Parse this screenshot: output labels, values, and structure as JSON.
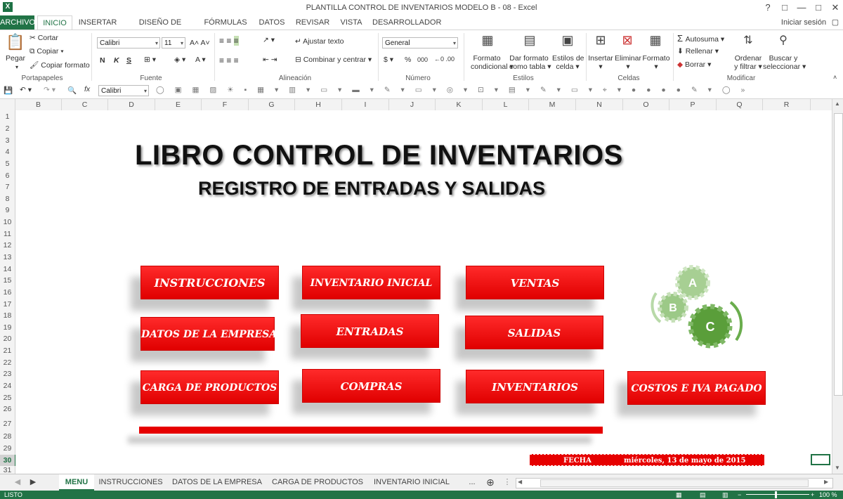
{
  "window": {
    "title": "PLANTILLA CONTROL DE INVENTARIOS MODELO B - 08 - Excel",
    "help": "?",
    "restore": "□",
    "minimize": "—",
    "maximize": "□",
    "close": "✕"
  },
  "ribbon_tabs": [
    "ARCHIVO",
    "INICIO",
    "INSERTAR",
    "DISEÑO DE PÁGINA",
    "FÓRMULAS",
    "DATOS",
    "REVISAR",
    "VISTA",
    "DESARROLLADOR"
  ],
  "signin": "Iniciar sesión",
  "ribbon": {
    "clipboard": {
      "paste": "Pegar",
      "cut": "Cortar",
      "copy": "Copiar",
      "format_painter": "Copiar formato",
      "label": "Portapapeles"
    },
    "font": {
      "name": "Calibri",
      "size": "11",
      "bold": "N",
      "italic": "K",
      "underline": "S",
      "label": "Fuente"
    },
    "alignment": {
      "wrap": "Ajustar texto",
      "merge": "Combinar y centrar",
      "label": "Alineación"
    },
    "number": {
      "format": "General",
      "percent": "%",
      "thousands": "000",
      "label": "Número"
    },
    "styles": {
      "conditional_1": "Formato",
      "conditional_2": "condicional",
      "table_1": "Dar formato",
      "table_2": "como tabla",
      "cell_1": "Estilos de",
      "cell_2": "celda",
      "label": "Estilos"
    },
    "cells": {
      "insert": "Insertar",
      "delete": "Eliminar",
      "format": "Formato",
      "label": "Celdas"
    },
    "editing": {
      "autosum": "Autosuma",
      "fill": "Rellenar",
      "clear": "Borrar",
      "sort_1": "Ordenar",
      "sort_2": "y filtrar",
      "find_1": "Buscar y",
      "find_2": "seleccionar",
      "label": "Modificar"
    }
  },
  "qat_font": "Calibri",
  "columns": [
    "B",
    "C",
    "D",
    "E",
    "F",
    "G",
    "H",
    "I",
    "J",
    "K",
    "L",
    "M",
    "N",
    "O",
    "P",
    "Q",
    "R"
  ],
  "rows": [
    "1",
    "2",
    "3",
    "4",
    "5",
    "6",
    "7",
    "8",
    "9",
    "10",
    "11",
    "12",
    "13",
    "14",
    "15",
    "16",
    "17",
    "18",
    "19",
    "20",
    "21",
    "22",
    "23",
    "24",
    "25",
    "26",
    "27",
    "28",
    "29",
    "30",
    "31"
  ],
  "selected_row": "30",
  "sheet": {
    "title": "LIBRO CONTROL DE INVENTARIOS",
    "subtitle": "REGISTRO DE ENTRADAS Y SALIDAS",
    "buttons": {
      "instrucciones": "INSTRUCCIONES",
      "inventario_inicial": "INVENTARIO INICIAL",
      "ventas": "VENTAS",
      "datos_empresa": "DATOS DE LA EMPRESA",
      "entradas": "ENTRADAS",
      "salidas": "SALIDAS",
      "carga_productos": "CARGA DE PRODUCTOS",
      "compras": "COMPRAS",
      "inventarios": "INVENTARIOS",
      "costos_iva": "COSTOS E IVA PAGADO"
    },
    "gears": {
      "a": "A",
      "b": "B",
      "c": "C"
    },
    "fecha_label": "FECHA",
    "fecha_value": "miércoles, 13 de mayo de 2015",
    "colors": {
      "button_red": "#e60000",
      "gear_green": "#5a9e3a",
      "excel_green": "#217346"
    }
  },
  "sheet_tabs": [
    "MENU",
    "INSTRUCCIONES",
    "DATOS DE LA EMPRESA",
    "CARGA DE PRODUCTOS",
    "INVENTARIO INICIAL",
    "..."
  ],
  "active_sheet": "MENU",
  "status": {
    "mode": "LISTO",
    "zoom": "100 %"
  }
}
